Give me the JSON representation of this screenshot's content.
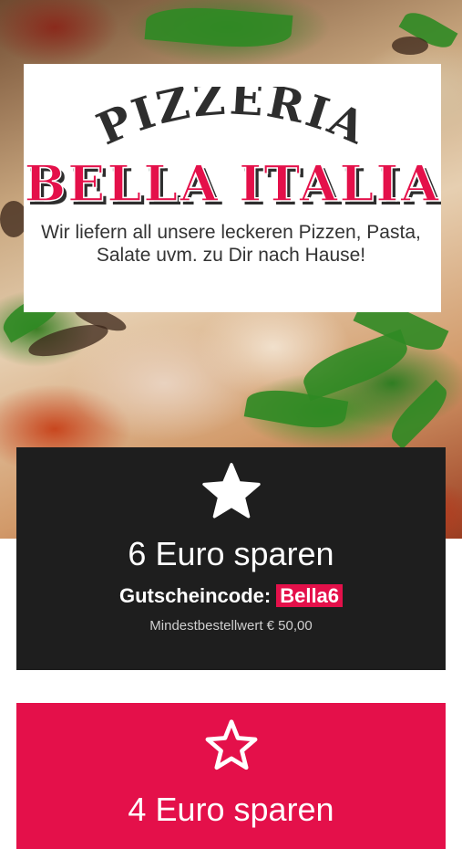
{
  "header": {
    "logo_line1": "PIZZERIA",
    "logo_line2": "BELLA ITALIA",
    "tagline": "Wir liefern all unsere leckeren Pizzen, Pasta, Salate uvm. zu Dir nach Hause!"
  },
  "offers": [
    {
      "icon": "star-filled-icon",
      "title": "6 Euro sparen",
      "code_label": "Gutscheincode:",
      "code": "Bella6",
      "min_order": "Mindestbestellwert € 50,00"
    },
    {
      "icon": "star-outline-icon",
      "title": "4 Euro sparen"
    }
  ],
  "colors": {
    "brand_red": "#e4104a",
    "dark_card": "#1e1e1e",
    "logo_dark": "#2e2e2e"
  }
}
